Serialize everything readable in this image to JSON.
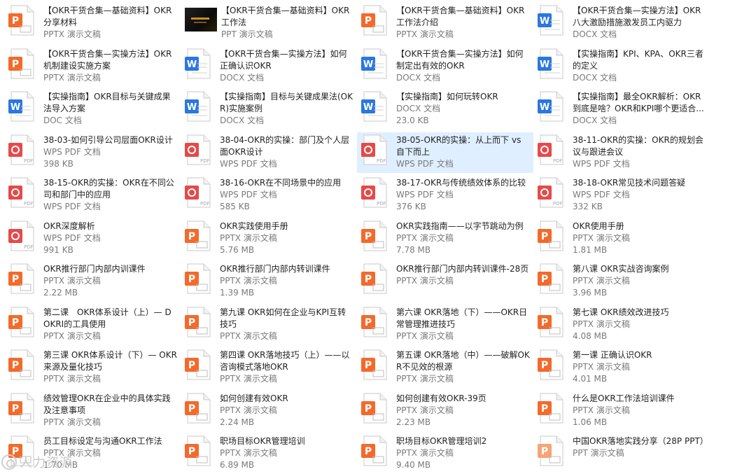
{
  "colors": {
    "pptx": "#f26a2c",
    "docx": "#2b77e0",
    "pdf": "#e54a4a",
    "ppt": "#f7a376",
    "selected_bg": "#dfefff"
  },
  "files": [
    {
      "name": "【OKR干货合集—基础资料】OKR分享材料",
      "type": "PPTX 演示文稿",
      "size": "",
      "icon": "pptx-icon"
    },
    {
      "name": "【OKR干货合集—基础资料】OKR工作法",
      "type": "PPT 演示文稿",
      "size": "",
      "icon": "thumbnail"
    },
    {
      "name": "【OKR干货合集—基础资料】OKR工作法介绍",
      "type": "PPTX 演示文稿",
      "size": "",
      "icon": "pptx-icon"
    },
    {
      "name": "【OKR干货合集—实操方法】OKR八大激励措施激发员工内驱力",
      "type": "DOCX 文档",
      "size": "",
      "icon": "docx-icon"
    },
    {
      "name": "【OKR干货合集—实操方法】OKR机制建设实施方案",
      "type": "PPTX 演示文稿",
      "size": "",
      "icon": "pptx-icon"
    },
    {
      "name": "【OKR干货合集—实操方法】如何正确认识OKR",
      "type": "DOCX 文档",
      "size": "",
      "icon": "docx-icon"
    },
    {
      "name": "【OKR干货合集—实操方法】如何制定出有效的OKR",
      "type": "DOCX 文档",
      "size": "",
      "icon": "docx-icon"
    },
    {
      "name": "【实操指南】KPI、KPA、OKR三者的定义",
      "type": "DOCX 文档",
      "size": "",
      "icon": "docx-icon"
    },
    {
      "name": "【实操指南】OKR目标与关键成果法导入方案",
      "type": "DOC 文档",
      "size": "",
      "icon": "doc-icon"
    },
    {
      "name": "【实操指南】目标与关键成果法(OKR)实施案例",
      "type": "DOCX 文档",
      "size": "",
      "icon": "docx-icon"
    },
    {
      "name": "【实操指南】如何玩转OKR",
      "type": "DOCX 文档",
      "size": "23.0 KB",
      "icon": "docx-icon"
    },
    {
      "name": "【实操指南】最全OKR解析：OKR到底是啥？OKR和KPI哪个更适合...",
      "type": "DOCX 文档",
      "size": "",
      "icon": "docx-icon"
    },
    {
      "name": "38-03-如何引导公司层面OKR设计",
      "type": "WPS PDF 文档",
      "size": "398 KB",
      "icon": "pdf-icon"
    },
    {
      "name": "38-04-OKR的实操：部门及个人层面OKR设计",
      "type": "WPS PDF 文档",
      "size": "",
      "icon": "pdf-icon"
    },
    {
      "name": "38-05-OKR的实操：从上而下 vs 自下而上",
      "type": "WPS PDF 文档",
      "size": "",
      "icon": "pdf-icon",
      "selected": true
    },
    {
      "name": "38-11-OKR的实操：OKR的规划会议与跟进会议",
      "type": "WPS PDF 文档",
      "size": "",
      "icon": "pdf-icon"
    },
    {
      "name": "38-15-OKR的实操：OKR在不同公司和部门中的应用",
      "type": "WPS PDF 文档",
      "size": "",
      "icon": "pdf-icon"
    },
    {
      "name": "38-16-OKR在不同场景中的应用",
      "type": "WPS PDF 文档",
      "size": "585 KB",
      "icon": "pdf-icon"
    },
    {
      "name": "38-17-OKR与传统绩效体系的比较",
      "type": "WPS PDF 文档",
      "size": "376 KB",
      "icon": "pdf-icon"
    },
    {
      "name": "38-18-OKR常见技术问题答疑",
      "type": "WPS PDF 文档",
      "size": "332 KB",
      "icon": "pdf-icon"
    },
    {
      "name": "OKR深度解析",
      "type": "WPS PDF 文档",
      "size": "991 KB",
      "icon": "pdf-icon"
    },
    {
      "name": "OKR实践使用手册",
      "type": "PPTX 演示文稿",
      "size": "5.76 MB",
      "icon": "pptx-icon"
    },
    {
      "name": "OKR实践指南——以字节跳动为例",
      "type": "PPTX 演示文稿",
      "size": "7.78 MB",
      "icon": "pptx-icon"
    },
    {
      "name": "OKR使用手册",
      "type": "PPTX 演示文稿",
      "size": "1.81 MB",
      "icon": "pptx-icon"
    },
    {
      "name": "OKR推行部门内部内训课件",
      "type": "PPTX 演示文稿",
      "size": "2.22 MB",
      "icon": "pptx-icon"
    },
    {
      "name": "OKR推行部门内部内转训课件",
      "type": "PPTX 演示文稿",
      "size": "1.39 MB",
      "icon": "pptx-icon"
    },
    {
      "name": "OKR推行部门内部内转训课件-28页",
      "type": "PPTX 演示文稿",
      "size": "",
      "icon": "pptx-icon"
    },
    {
      "name": "第八课 OKR实战咨询案例",
      "type": "PPTX 演示文稿",
      "size": "3.96 MB",
      "icon": "pptx-icon"
    },
    {
      "name": "第二课　OKR体系设计（上）— DOKRI的工具使用",
      "type": "PPTX 演示文稿",
      "size": "",
      "icon": "pptx-icon"
    },
    {
      "name": "第九课 OKR如何在企业与KPI互转技巧",
      "type": "PPTX 演示文稿",
      "size": "",
      "icon": "pptx-icon"
    },
    {
      "name": "第六课 OKR落地（下）——OKR日常管理推进技巧",
      "type": "PPTX 演示文稿",
      "size": "",
      "icon": "pptx-icon"
    },
    {
      "name": "第七课 OKR绩效改进技巧",
      "type": "PPTX 演示文稿",
      "size": "4.08 MB",
      "icon": "pptx-icon"
    },
    {
      "name": "第三课 OKR体系设计（下）— OKR来源及量化技巧",
      "type": "PPTX 演示文稿",
      "size": "",
      "icon": "pptx-icon"
    },
    {
      "name": "第四课 OKR落地技巧（上）——以咨询模式落地OKR",
      "type": "PPTX 演示文稿",
      "size": "",
      "icon": "pptx-icon"
    },
    {
      "name": "第五课 OKR落地（中）——破解OKR不见效的根源",
      "type": "PPTX 演示文稿",
      "size": "",
      "icon": "pptx-icon"
    },
    {
      "name": "第一课 正确认识OKR",
      "type": "PPTX 演示文稿",
      "size": "4.01 MB",
      "icon": "pptx-icon"
    },
    {
      "name": "绩效管理OKR在企业中的具体实践及注意事项",
      "type": "PPTX 演示文稿",
      "size": "",
      "icon": "pptx-icon"
    },
    {
      "name": "如何创建有效OKR",
      "type": "PPTX 演示文稿",
      "size": "2.24 MB",
      "icon": "pptx-icon"
    },
    {
      "name": "如何创建有效OKR-39页",
      "type": "PPTX 演示文稿",
      "size": "2.23 MB",
      "icon": "pptx-icon"
    },
    {
      "name": "什么是OKR工作法培训课件",
      "type": "PPTX 演示文稿",
      "size": "1.06 MB",
      "icon": "pptx-icon"
    },
    {
      "name": "员工目标设定与沟通OKR工作法",
      "type": "PPTX 演示文稿",
      "size": "1.70 MB",
      "icon": "pptx-icon"
    },
    {
      "name": "职场目标OKR管理培训",
      "type": "PPTX 演示文稿",
      "size": "6.89 MB",
      "icon": "pptx-icon"
    },
    {
      "name": "职场目标OKR管理培训2",
      "type": "PPTX 演示文稿",
      "size": "9.40 MB",
      "icon": "pptx-icon"
    },
    {
      "name": "中国OKR落地实践分享（28P PPT）",
      "type": "PPT 演示文稿",
      "size": "",
      "icon": "ppt-icon"
    }
  ],
  "watermark": {
    "text": "人力资源"
  }
}
